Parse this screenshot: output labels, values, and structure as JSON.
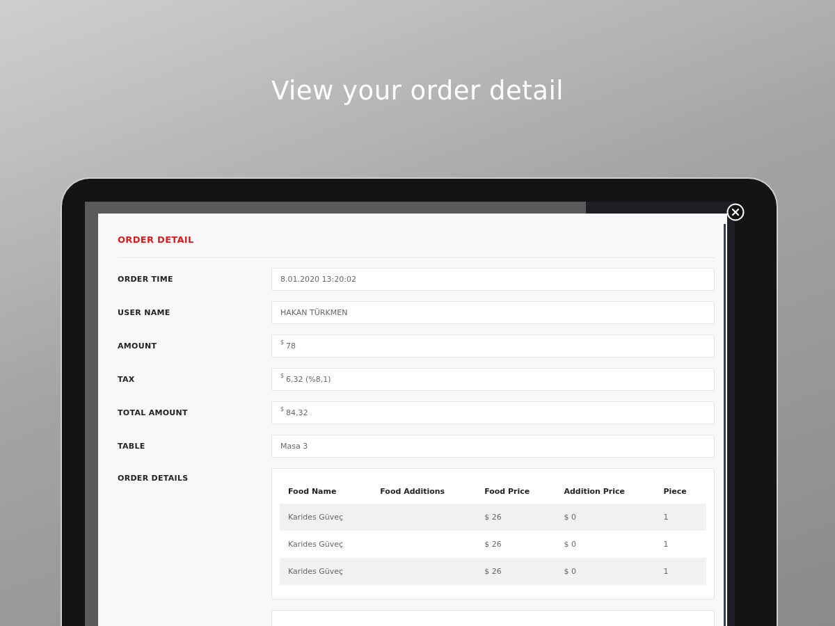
{
  "headline": "View your order detail",
  "modal": {
    "title": "ORDER DETAIL",
    "fields": [
      {
        "label": "ORDER TIME",
        "value": "8.01.2020 13:20:02"
      },
      {
        "label": "USER NAME",
        "value": "HAKAN TÜRKMEN"
      },
      {
        "label": "AMOUNT",
        "currency": "$",
        "value": "78"
      },
      {
        "label": "TAX",
        "currency": "$",
        "value": "6,32 (%8,1)"
      },
      {
        "label": "TOTAL AMOUNT",
        "currency": "$",
        "value": "84,32"
      },
      {
        "label": "TABLE",
        "value": "Masa 3"
      }
    ],
    "order_details": {
      "label": "ORDER DETAILS",
      "columns": [
        "Food Name",
        "Food Additions",
        "Food Price",
        "Addition Price",
        "Piece"
      ],
      "rows": [
        [
          "Karides Güveç",
          "",
          "$ 26",
          "$ 0",
          "1"
        ],
        [
          "Karides Güveç",
          "",
          "$ 26",
          "$ 0",
          "1"
        ],
        [
          "Karides Güveç",
          "",
          "$ 26",
          "$ 0",
          "1"
        ]
      ]
    }
  }
}
